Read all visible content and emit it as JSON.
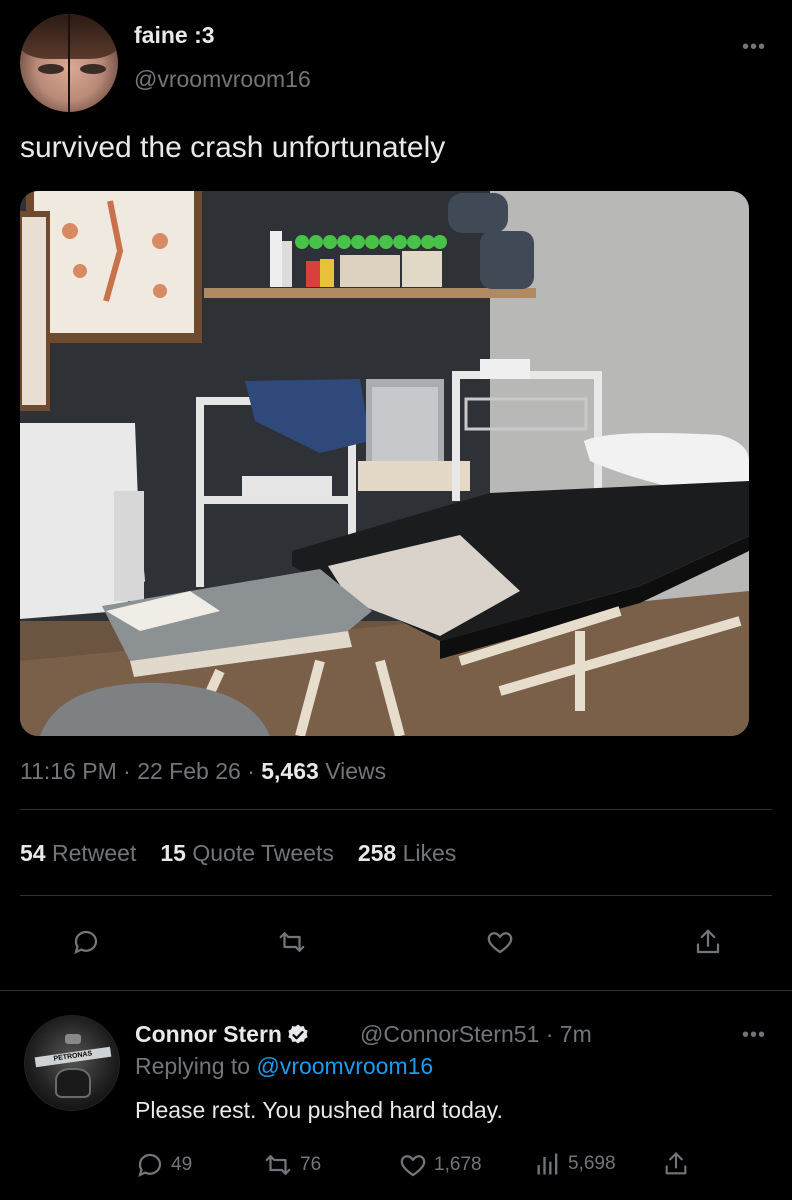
{
  "tweet": {
    "display_name": "faine :3",
    "handle": "@vroomvroom16",
    "text": "survived the crash unfortunately",
    "more_icon": "more-dots-icon",
    "photo_alt": "physiotherapy room with a black treatment table",
    "time": "11:16 PM",
    "sep": "·",
    "date": "22 Feb 26",
    "views_count": "5,463",
    "views_label": "Views",
    "stats": {
      "retweets_count": "54",
      "retweets_label": "Retweet",
      "quotes_count": "15",
      "quotes_label": "Quote Tweets",
      "likes_count": "258",
      "likes_label": "Likes"
    },
    "actions": [
      "reply-icon",
      "retweet-icon",
      "like-icon",
      "share-icon"
    ]
  },
  "reply": {
    "display_name": "Connor Stern",
    "verified": true,
    "handle_time": "@ConnorStern51 · 7m",
    "replying_prefix": "Replying to",
    "replying_to": "@vroomvroom16",
    "text": "Please rest. You pushed hard today.",
    "avatar_band_text": "PETRONAS",
    "counts": {
      "replies": "49",
      "retweets": "76",
      "likes": "1,678",
      "views": "5,698"
    }
  },
  "colors": {
    "background": "#000000",
    "text": "#e7e9ea",
    "muted": "#71767b",
    "link": "#1d9bf0",
    "divider": "#2f3336"
  }
}
